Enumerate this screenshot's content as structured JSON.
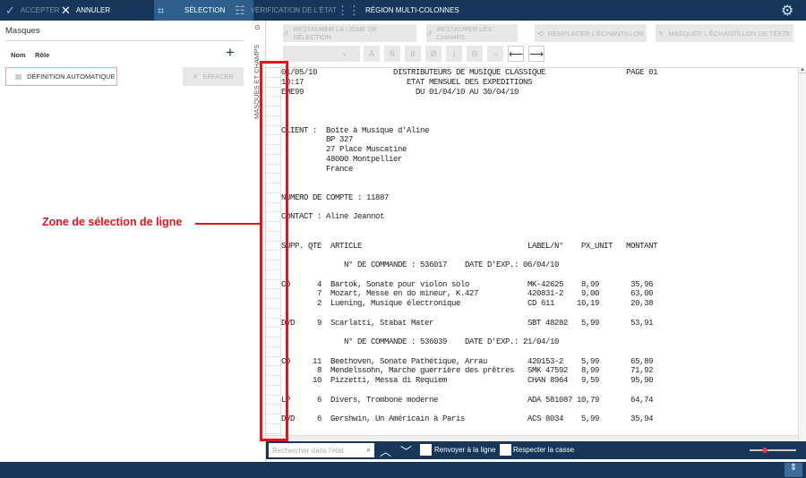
{
  "topbar": {
    "accept": "ACCEPTER",
    "cancel": "ANNULER",
    "selection": "SÉLECTION",
    "verification": "VÉRIFICATION DE L'ÉTAT",
    "multicol": "RÉGION MULTI-COLONNES"
  },
  "left": {
    "title": "Masques",
    "col_name": "Nom",
    "col_role": "Rôle",
    "add": "+",
    "auto_def": "DÉFINITION AUTOMATIQUE",
    "clear": "EFFACER",
    "strip_label": "MASQUES ET CHAMPS"
  },
  "toolbar": {
    "restore_line": "RESTAURER LA LIGNE DE SÉLECTION",
    "restore_fields": "RESTAURER LES CHAMPS",
    "replace_sample": "REMPLACER L'ÉCHANTILLON",
    "hide_sample": "MASQUER L'ÉCHANTILLON DE TEXTE",
    "chars": [
      "Ā",
      "Ñ",
      "ß",
      "Ø",
      "|",
      "Θ",
      "¬"
    ],
    "arrow_left": "⟵",
    "arrow_right": "⟶"
  },
  "report": {
    "title_lines": [
      {
        "left": "01/05/10",
        "center": "DISTRIBUTEURS DE MUSIQUE CLASSIQUE",
        "right": "PAGE 01"
      },
      {
        "left": "10:17",
        "center": "ETAT MENSUEL DES EXPEDITIONS"
      },
      {
        "left": "EME99",
        "center": "DU 01/04/10 AU 30/04/10"
      }
    ],
    "client_label": "CLIENT :",
    "client": [
      "Boîte à Musique d'Aline",
      "BP 327",
      "27 Place Muscatine",
      "48000 Montpellier",
      "France"
    ],
    "account": "NUMERO DE COMPTE : 11887",
    "contact": "CONTACT : Aline Jeannot",
    "headers": [
      "SUPP.",
      "QTE",
      "ARTICLE",
      "LABEL/N°",
      "PX_UNIT",
      "MONTANT"
    ],
    "orders": [
      {
        "order": "N° DE COMMANDE : 536017",
        "date": "DATE D'EXP.: 06/04/10",
        "groups": [
          [
            {
              "supp": "CD",
              "qty": "4",
              "article": "Bartok, Sonate pour violon solo",
              "label": "MK-42625",
              "price": "8,99",
              "amount": "35,96"
            },
            {
              "supp": "",
              "qty": "7",
              "article": "Mozart, Messe en do mineur, K.427",
              "label": "420831-2",
              "price": "9,00",
              "amount": "63,00"
            },
            {
              "supp": "",
              "qty": "2",
              "article": "Luening, Musique électronique",
              "label": "CD 611",
              "price": "10,19",
              "amount": "20,38"
            }
          ],
          [
            {
              "supp": "DVD",
              "qty": "9",
              "article": "Scarlatti, Stabat Mater",
              "label": "SBT 48282",
              "price": "5,99",
              "amount": "53,91"
            }
          ]
        ]
      },
      {
        "order": "N° DE COMMANDE : 536039",
        "date": "DATE D'EXP.: 21/04/10",
        "groups": [
          [
            {
              "supp": "CD",
              "qty": "11",
              "article": "Beethoven, Sonate Pathétique, Arrau",
              "label": "420153-2",
              "price": "5,99",
              "amount": "65,89"
            },
            {
              "supp": "",
              "qty": "8",
              "article": "Mendelssohn, Marche guerrière des prêtres",
              "label": "SMK 47592",
              "price": "8,99",
              "amount": "71,92"
            },
            {
              "supp": "",
              "qty": "10",
              "article": "Pizzetti, Messa di Requiem",
              "label": "CHAN 8964",
              "price": "9,59",
              "amount": "95,90"
            }
          ],
          [
            {
              "supp": "LP",
              "qty": "6",
              "article": "Divers, Trombone moderne",
              "label": "ADA 581087",
              "price": "10,79",
              "amount": "64,74"
            }
          ],
          [
            {
              "supp": "DVD",
              "qty": "6",
              "article": "Gershwin, Un Américain à Paris",
              "label": "ACS 8034",
              "price": "5,99",
              "amount": "35,94"
            }
          ]
        ]
      }
    ]
  },
  "search": {
    "placeholder": "Rechercher dans l'état",
    "wrap": "Renvoyer à la ligne",
    "case": "Respecter la casse"
  },
  "annotation": "Zone de sélection de ligne",
  "colors": {
    "navy": "#17375a",
    "selected_tab": "#2e5f8c",
    "annotation": "#e3141d"
  }
}
